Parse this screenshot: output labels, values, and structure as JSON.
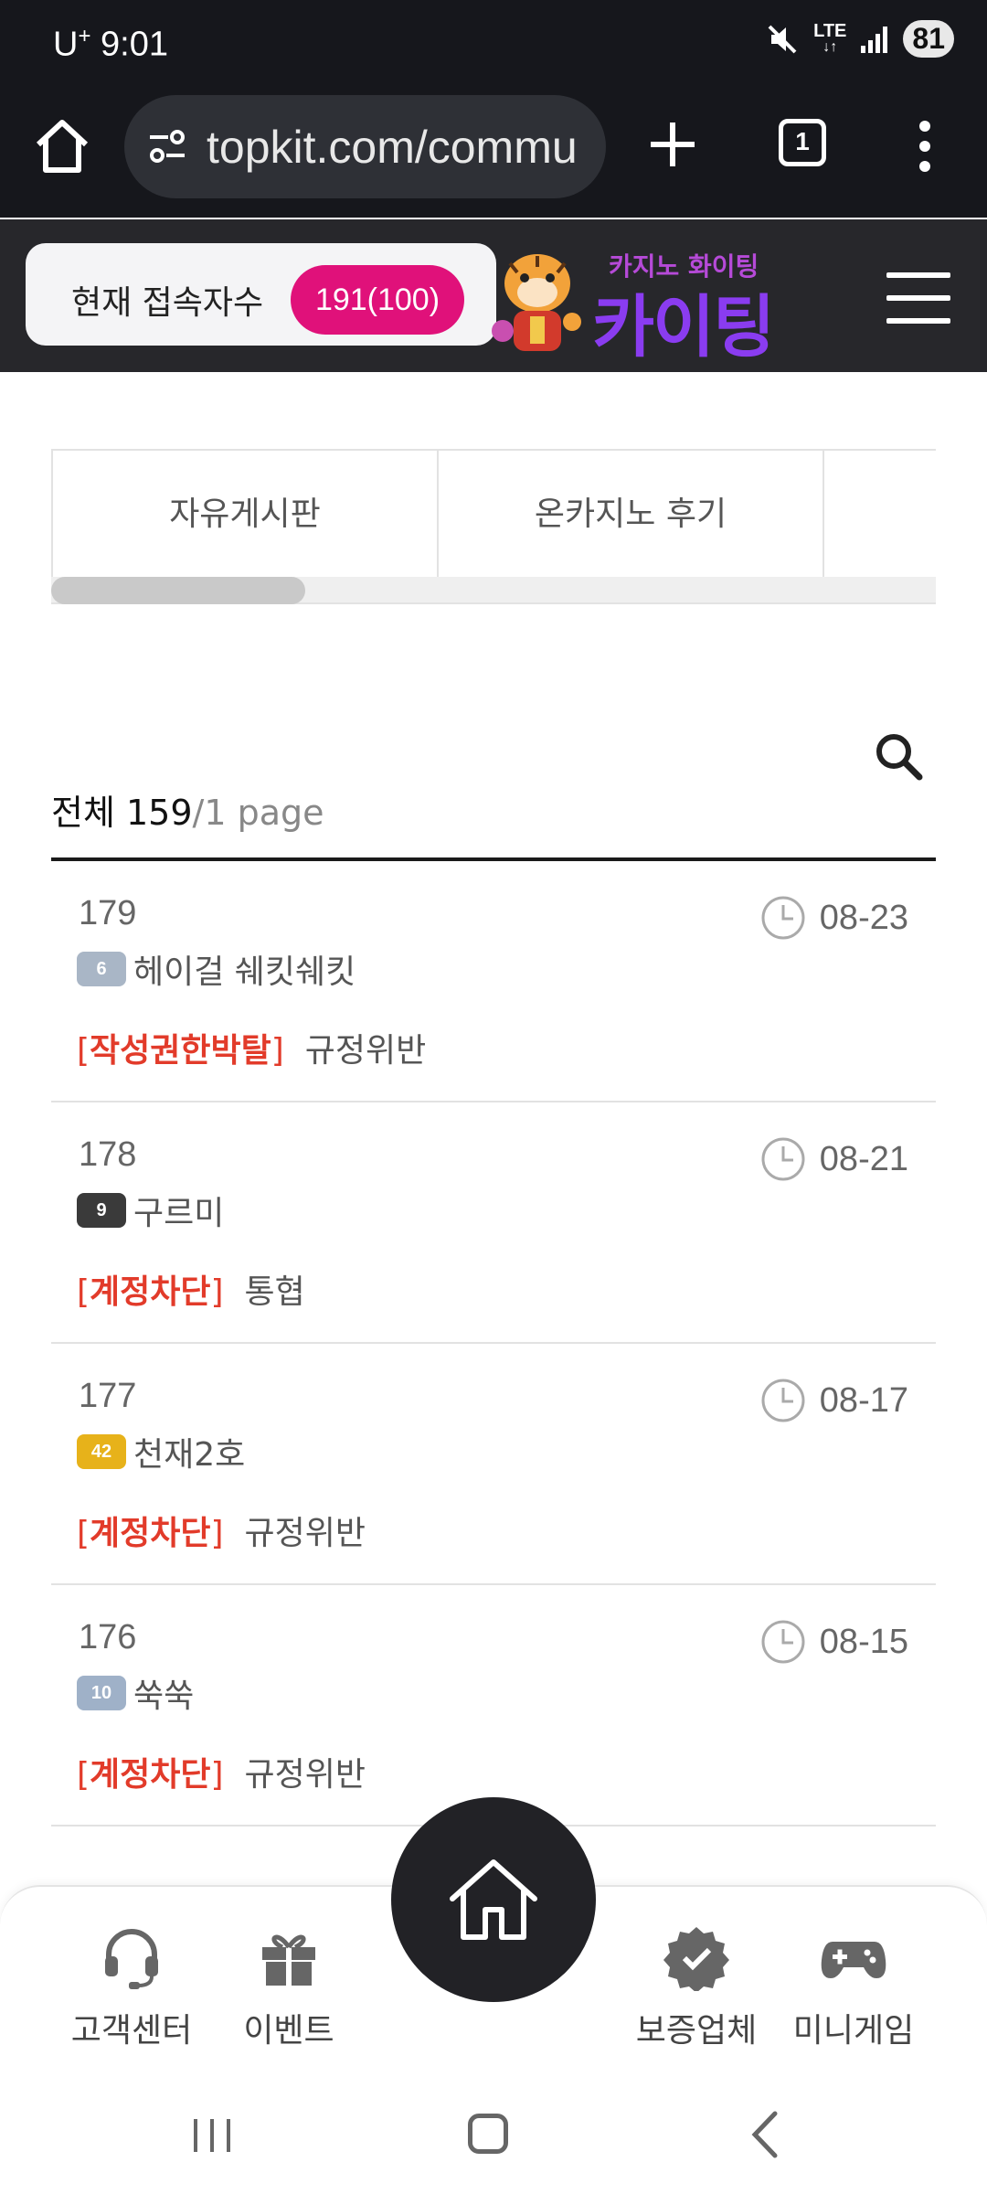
{
  "status_bar": {
    "carrier": "U",
    "carrier_sup": "+",
    "time": "9:01",
    "network": "LTE",
    "battery": "81"
  },
  "browser": {
    "url": "topkit.com/commu",
    "tab_count": "1"
  },
  "header": {
    "visitor_label": "현재 접속자수",
    "visitor_count": "191(100)",
    "logo_sub": "카지노 화이팅",
    "logo_main": "카이팅"
  },
  "category_tabs": [
    {
      "label": "자유게시판"
    },
    {
      "label": "온카지노 후기"
    },
    {
      "label": ""
    }
  ],
  "list_summary": {
    "total_label": "전체 159",
    "slash": "/",
    "page_label": "1 page"
  },
  "posts": [
    {
      "num": "179",
      "date": "08-23",
      "level": "6",
      "level_color": "#a9b6c6",
      "author": "헤이걸 쉐킷쉐킷",
      "tag": "작성권한박탈",
      "title": "규정위반"
    },
    {
      "num": "178",
      "date": "08-21",
      "level": "9",
      "level_color": "#3a3a3a",
      "author": "구르미",
      "tag": "계정차단",
      "title": "통협"
    },
    {
      "num": "177",
      "date": "08-17",
      "level": "42",
      "level_color": "#e7b21a",
      "author": "천재2호",
      "tag": "계정차단",
      "title": "규정위반"
    },
    {
      "num": "176",
      "date": "08-15",
      "level": "10",
      "level_color": "#9fb1c8",
      "author": "쑥쑥",
      "tag": "계정차단",
      "title": "규정위반"
    }
  ],
  "bottom_nav": {
    "customer_center": "고객센터",
    "event": "이벤트",
    "guarantee": "보증업체",
    "mini_game": "미니게임"
  },
  "colors": {
    "accent_pink": "#e0117a",
    "tag_red": "#e23b2a",
    "logo_purple": "#8a3cf0",
    "dark_bar": "#16171c"
  }
}
